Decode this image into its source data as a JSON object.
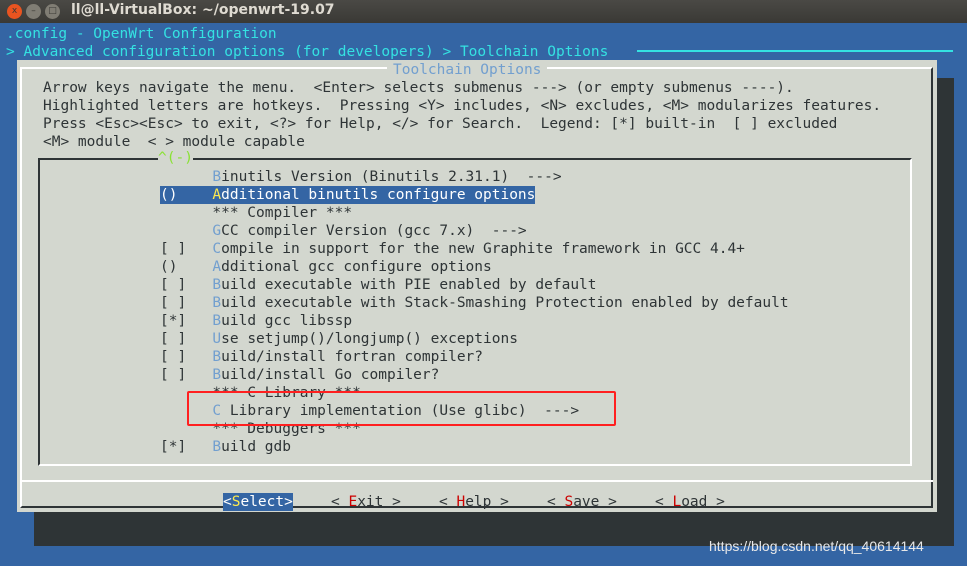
{
  "window": {
    "title": "ll@ll-VirtualBox: ~/openwrt-19.07",
    "buttons": [
      "close",
      "minimize",
      "maximize"
    ]
  },
  "header": {
    "config_line": ".config - OpenWrt Configuration",
    "breadcrumb": "> Advanced configuration options (for developers) > Toolchain Options"
  },
  "dialog": {
    "title": "Toolchain Options",
    "help": [
      "Arrow keys navigate the menu.  <Enter> selects submenus ---> (or empty submenus ----).",
      "Highlighted letters are hotkeys.  Pressing <Y> includes, <N> excludes, <M> modularizes features.",
      "Press <Esc><Esc> to exit, <?> for Help, </> for Search.  Legend: [*] built-in  [ ] excluded",
      "<M> module  < > module capable"
    ],
    "scroll_indicator": "^(-)",
    "items": [
      {
        "prefix": "      ",
        "hotkey": "B",
        "text": "inutils Version (Binutils 2.31.1)  --->"
      },
      {
        "prefix": "()    ",
        "hotkey": "A",
        "text": "dditional binutils configure options",
        "selected": true
      },
      {
        "prefix": "      ",
        "hotkey": "",
        "text": "*** Compiler ***"
      },
      {
        "prefix": "      ",
        "hotkey": "G",
        "text": "CC compiler Version (gcc 7.x)  --->"
      },
      {
        "prefix": "[ ]   ",
        "hotkey": "C",
        "text": "ompile in support for the new Graphite framework in GCC 4.4+"
      },
      {
        "prefix": "()    ",
        "hotkey": "A",
        "text": "dditional gcc configure options"
      },
      {
        "prefix": "[ ]   ",
        "hotkey": "B",
        "text": "uild executable with PIE enabled by default"
      },
      {
        "prefix": "[ ]   ",
        "hotkey": "B",
        "text": "uild executable with Stack-Smashing Protection enabled by default"
      },
      {
        "prefix": "[*]   ",
        "hotkey": "B",
        "text": "uild gcc libssp"
      },
      {
        "prefix": "[ ]   ",
        "hotkey": "U",
        "text": "se setjump()/longjump() exceptions"
      },
      {
        "prefix": "[ ]   ",
        "hotkey": "B",
        "text": "uild/install fortran compiler?"
      },
      {
        "prefix": "[ ]   ",
        "hotkey": "B",
        "text": "uild/install Go compiler?"
      },
      {
        "prefix": "      ",
        "hotkey": "",
        "text": "*** C Library ***"
      },
      {
        "prefix": "      ",
        "hotkey": "C",
        "text": " Library implementation (Use glibc)  --->"
      },
      {
        "prefix": "      ",
        "hotkey": "",
        "text": "*** Debuggers ***"
      },
      {
        "prefix": "[*]   ",
        "hotkey": "B",
        "text": "uild gdb"
      }
    ],
    "buttons": [
      {
        "pre": "<",
        "hotkey": "S",
        "post": "elect>",
        "active": true
      },
      {
        "pre": "< ",
        "hotkey": "E",
        "post": "xit >"
      },
      {
        "pre": "< ",
        "hotkey": "H",
        "post": "elp >"
      },
      {
        "pre": "< ",
        "hotkey": "S",
        "post": "ave >"
      },
      {
        "pre": "< ",
        "hotkey": "L",
        "post": "oad >"
      }
    ]
  },
  "watermark": "https://blog.csdn.net/qq_40614144",
  "colors": {
    "background": "#3465a4",
    "dialog": "#d3d7cf",
    "hotkey": "#729fcf",
    "annotation": "#ff2020"
  }
}
